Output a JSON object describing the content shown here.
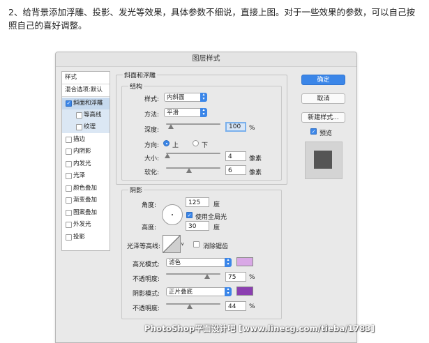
{
  "intro_text": "2、给背景添加浮雕、投影、发光等效果，具体参数不细说，直接上图。对于一些效果的参数，可以自己按照自己的喜好调整。",
  "dialog": {
    "title": "图层样式",
    "styles_panel": {
      "header": "样式",
      "blend_options": "混合选项:默认",
      "items": [
        {
          "label": "斜面和浮雕",
          "checked": true,
          "selected": true
        },
        {
          "label": "等高线",
          "checked": false,
          "sub": true
        },
        {
          "label": "纹理",
          "checked": false,
          "sub": true
        },
        {
          "label": "描边",
          "checked": false
        },
        {
          "label": "内阴影",
          "checked": false
        },
        {
          "label": "内发光",
          "checked": false
        },
        {
          "label": "光泽",
          "checked": false
        },
        {
          "label": "颜色叠加",
          "checked": false
        },
        {
          "label": "渐变叠加",
          "checked": false
        },
        {
          "label": "图案叠加",
          "checked": false
        },
        {
          "label": "外发光",
          "checked": false
        },
        {
          "label": "投影",
          "checked": false
        }
      ]
    },
    "bevel": {
      "section_title": "斜面和浮雕",
      "structure_title": "结构",
      "style_label": "样式:",
      "style_value": "内斜面",
      "technique_label": "方法:",
      "technique_value": "平滑",
      "depth_label": "深度:",
      "depth_value": "100",
      "depth_unit": "%",
      "direction_label": "方向:",
      "direction_up": "上",
      "direction_down": "下",
      "size_label": "大小:",
      "size_value": "4",
      "size_unit": "像素",
      "soften_label": "软化:",
      "soften_value": "6",
      "soften_unit": "像素",
      "depth_slider": 0.09,
      "size_slider": 0.02,
      "soften_slider": 0.42
    },
    "shading": {
      "title": "阴影",
      "angle_label": "角度:",
      "angle_value": "125",
      "angle_unit": "度",
      "global_light_label": "使用全局光",
      "global_light_checked": true,
      "altitude_label": "高度:",
      "altitude_value": "30",
      "altitude_unit": "度",
      "gloss_contour_label": "光泽等高线:",
      "anti_alias_label": "消除锯齿",
      "anti_alias_checked": false,
      "highlight_mode_label": "高光模式:",
      "highlight_mode_value": "滤色",
      "highlight_color": "#d9a8e6",
      "highlight_opacity_label": "不透明度:",
      "highlight_opacity_value": "75",
      "highlight_opacity_unit": "%",
      "shadow_mode_label": "阴影模式:",
      "shadow_mode_value": "正片叠底",
      "shadow_color": "#8b3fb0",
      "shadow_opacity_label": "不透明度:",
      "shadow_opacity_value": "44",
      "shadow_opacity_unit": "%",
      "highlight_slider": 0.75,
      "shadow_slider": 0.44
    },
    "buttons": {
      "ok": "确定",
      "cancel": "取消",
      "new_style": "新建样式...",
      "preview_label": "预览",
      "preview_checked": true
    },
    "colors": {
      "accent": "#3b86e8",
      "preview_swatch": "#555555"
    }
  },
  "watermark": "PhotoShop平面设计吧 [www.linecg.com/tieba/1783]"
}
